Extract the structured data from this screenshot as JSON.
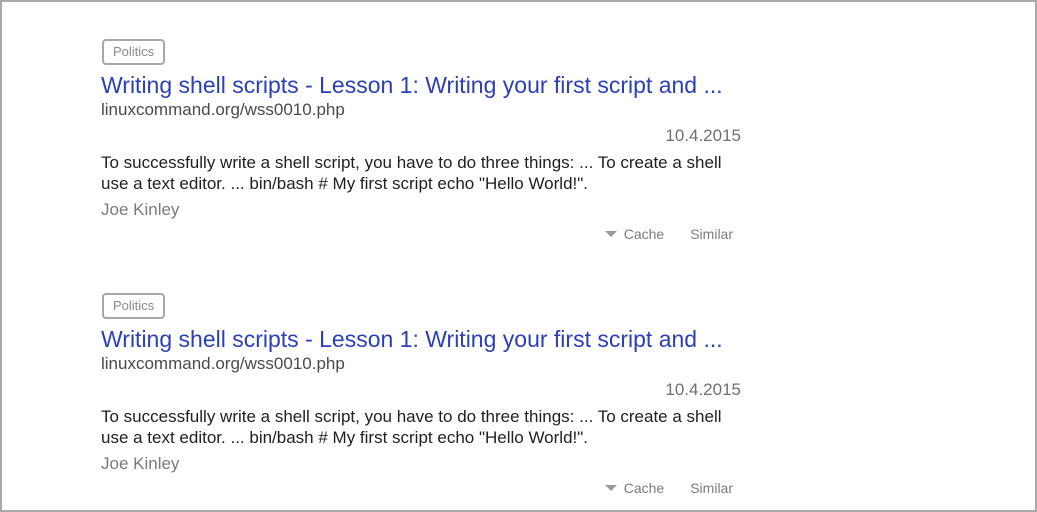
{
  "results": [
    {
      "tag": "Politics",
      "title": "Writing shell scripts - Lesson 1: Writing your first script and ...",
      "url": "linuxcommand.org/wss0010.php",
      "date": "10.4.2015",
      "snippet_line1": "To successfully write a shell script, you have to do three things: ... To create a shell",
      "snippet_line2": "use a text editor. ... bin/bash # My first script echo \"Hello World!\".",
      "author": "Joe Kinley",
      "cache_label": "Cache",
      "similar_label": "Similar"
    },
    {
      "tag": "Politics",
      "title": "Writing shell scripts - Lesson 1: Writing your first script and ...",
      "url": "linuxcommand.org/wss0010.php",
      "date": "10.4.2015",
      "snippet_line1": "To successfully write a shell script, you have to do three things: ... To create a shell",
      "snippet_line2": "use a text editor. ... bin/bash # My first script echo \"Hello World!\".",
      "author": "Joe Kinley",
      "cache_label": "Cache",
      "similar_label": "Similar"
    }
  ]
}
